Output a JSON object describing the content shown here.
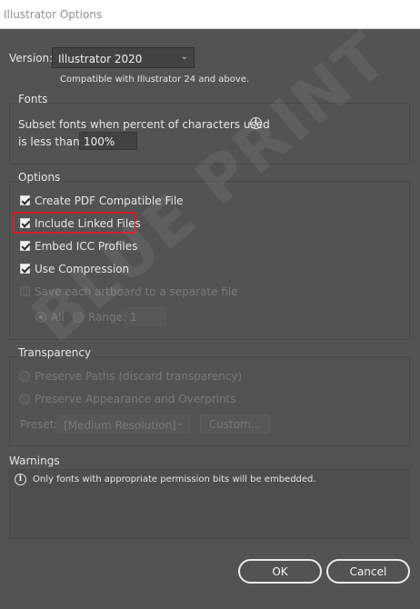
{
  "window": {
    "title": "Illustrator Options"
  },
  "version": {
    "label": "Version:",
    "selected": "Illustrator 2020",
    "note": "Compatible with Illustrator 24 and above."
  },
  "fonts": {
    "title": "Fonts",
    "subset_line1": "Subset fonts when percent of characters used",
    "subset_line2": "is less than:",
    "subset_value": "100%"
  },
  "options": {
    "title": "Options",
    "create_pdf": "Create PDF Compatible File",
    "include_linked": "Include Linked Files",
    "embed_icc": "Embed ICC Profiles",
    "use_compression": "Use Compression",
    "save_artboards": "Save each artboard to a separate file",
    "all_label": "All",
    "range_label": "Range:",
    "range_value": "1"
  },
  "transparency": {
    "title": "Transparency",
    "preserve_paths": "Preserve Paths (discard transparency)",
    "preserve_appearance": "Preserve Appearance and Overprints",
    "preset_label": "Preset:",
    "preset_value": "[Medium Resolution]",
    "custom_button": "Custom..."
  },
  "warnings": {
    "title": "Warnings",
    "message": "Only fonts with appropriate permission bits will be embedded."
  },
  "buttons": {
    "ok": "OK",
    "cancel": "Cancel"
  },
  "watermark": "BLUE PRINT",
  "colors": {
    "background": "#535353",
    "highlight": "#d11f2c"
  },
  "icons": {
    "info": "info-icon",
    "chevron": "chevron-down-icon"
  }
}
